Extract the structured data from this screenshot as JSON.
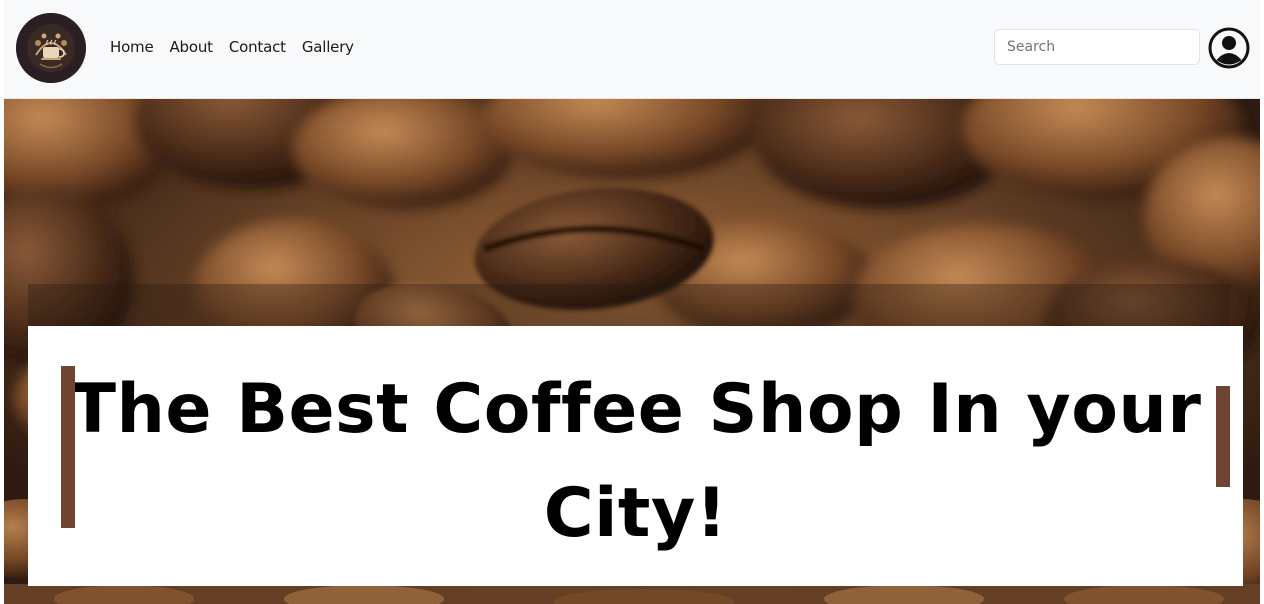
{
  "navbar": {
    "logo_alt": "Coffee",
    "links": [
      {
        "label": "Home"
      },
      {
        "label": "About"
      },
      {
        "label": "Contact"
      },
      {
        "label": "Gallery"
      }
    ],
    "search": {
      "placeholder": "Search",
      "value": ""
    }
  },
  "hero": {
    "title": "The Best Coffee Shop In your City!"
  },
  "colors": {
    "navbar_bg": "#f8f9fa",
    "logo_bg": "#2b1f24",
    "accent_bar": "#6e4533",
    "hero_card": "#ffffff"
  },
  "icons": [
    "coffee-logo-icon",
    "user-profile-icon"
  ]
}
